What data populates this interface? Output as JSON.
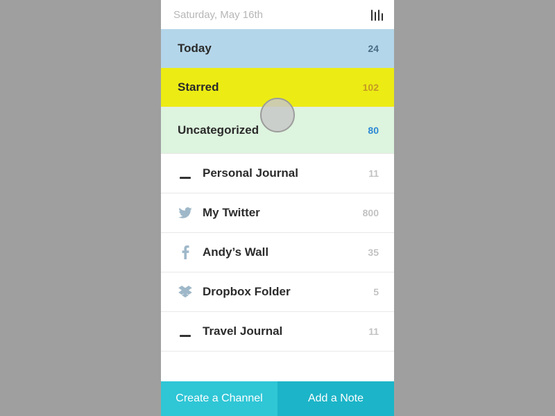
{
  "header": {
    "date": "Saturday, May 16th"
  },
  "smart_lists": {
    "today": {
      "label": "Today",
      "count": "24"
    },
    "starred": {
      "label": "Starred",
      "count": "102"
    },
    "uncat": {
      "label": "Uncategorized",
      "count": "80"
    }
  },
  "channels": [
    {
      "icon": "lines",
      "label": "Personal Journal",
      "count": "11"
    },
    {
      "icon": "twitter",
      "label": "My Twitter",
      "count": "800"
    },
    {
      "icon": "fb",
      "label": "Andy’s Wall",
      "count": "35"
    },
    {
      "icon": "dropbox",
      "label": "Dropbox Folder",
      "count": "5"
    },
    {
      "icon": "lines",
      "label": "Travel Journal",
      "count": "11"
    }
  ],
  "footer": {
    "create_channel": "Create a Channel",
    "add_note": "Add  a Note"
  },
  "colors": {
    "today_bg": "#b4d6ea",
    "starred_bg": "#ecec14",
    "uncat_bg": "#ddf4de",
    "accent": "#1cb4c8"
  }
}
